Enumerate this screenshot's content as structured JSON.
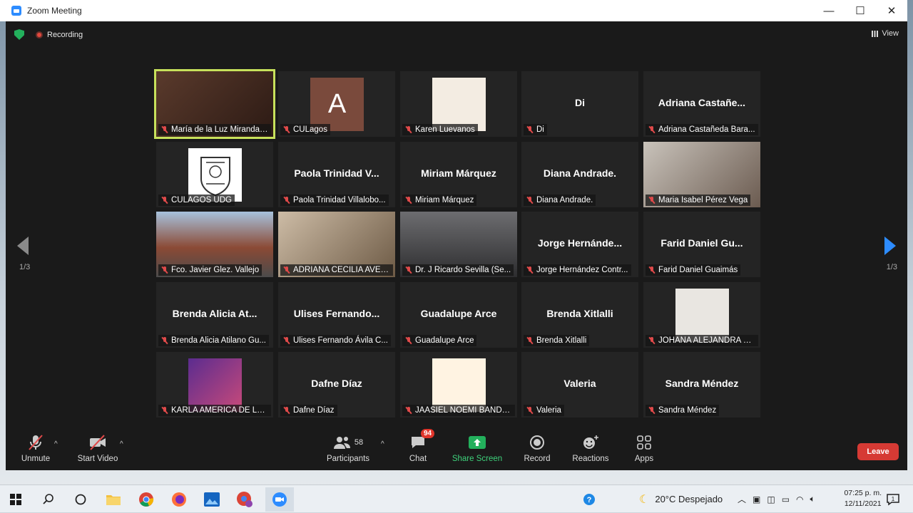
{
  "window": {
    "title": "Zoom Meeting",
    "min": "—",
    "max": "☐",
    "close": "✕"
  },
  "meeting": {
    "recording_label": "Recording",
    "view_label": "View"
  },
  "pager": {
    "left": "1/3",
    "right": "1/3"
  },
  "tiles": [
    {
      "label": "María de la Luz Miranda B...",
      "big": "",
      "kind": "photo",
      "active": true
    },
    {
      "label": "CULagos",
      "big": "",
      "kind": "avatar",
      "letter": "A"
    },
    {
      "label": "Karen Luevanos",
      "big": "",
      "kind": "photo"
    },
    {
      "label": "Di",
      "big": "Di",
      "kind": "name"
    },
    {
      "label": "Adriana Castañeda Bara...",
      "big": "Adriana  Castañe...",
      "kind": "name"
    },
    {
      "label": "CULAGOS UDG",
      "big": "",
      "kind": "logo"
    },
    {
      "label": "Paola Trinidad Villalobo...",
      "big": "Paola  Trinidad  V...",
      "kind": "name"
    },
    {
      "label": "Miriam Márquez",
      "big": "Miriam Márquez",
      "kind": "name"
    },
    {
      "label": "Diana Andrade.",
      "big": "Diana Andrade.",
      "kind": "name"
    },
    {
      "label": "Maria Isabel Pérez Vega",
      "big": "",
      "kind": "photo"
    },
    {
      "label": "Fco. Javier Glez. Vallejo",
      "big": "",
      "kind": "photo"
    },
    {
      "label": "ADRIANA CECILIA AVELA...",
      "big": "",
      "kind": "photo"
    },
    {
      "label": "Dr. J Ricardo Sevilla (Se...",
      "big": "",
      "kind": "photo"
    },
    {
      "label": "Jorge Hernández Contr...",
      "big": "Jorge  Hernánde...",
      "kind": "name"
    },
    {
      "label": "Farid Daniel Guaimás",
      "big": "Farid  Daniel  Gu...",
      "kind": "name"
    },
    {
      "label": "Brenda Alicia Atilano Gu...",
      "big": "Brenda  Alicia  At...",
      "kind": "name"
    },
    {
      "label": "Ulises Fernando Ávila C...",
      "big": "Ulises  Fernando...",
      "kind": "name"
    },
    {
      "label": "Guadalupe Arce",
      "big": "Guadalupe Arce",
      "kind": "name"
    },
    {
      "label": "Brenda Xitlalli",
      "big": "Brenda Xitlalli",
      "kind": "name"
    },
    {
      "label": "JOHANA ALEJANDRA M...",
      "big": "",
      "kind": "photo"
    },
    {
      "label": "KARLA AMERICA DE LA ...",
      "big": "",
      "kind": "photo"
    },
    {
      "label": "Dafne Díaz",
      "big": "Dafne Díaz",
      "kind": "name"
    },
    {
      "label": "JAASIEL NOEMI BANDA ...",
      "big": "",
      "kind": "photo"
    },
    {
      "label": "Valeria",
      "big": "Valeria",
      "kind": "name"
    },
    {
      "label": "Sandra Méndez",
      "big": "Sandra Méndez",
      "kind": "name"
    }
  ],
  "toolbar": {
    "unmute": "Unmute",
    "start_video": "Start Video",
    "participants": "Participants",
    "participants_count": "58",
    "chat": "Chat",
    "chat_badge": "94",
    "share": "Share Screen",
    "record": "Record",
    "reactions": "Reactions",
    "apps": "Apps",
    "leave": "Leave"
  },
  "taskbar": {
    "weather": "20°C  Despejado",
    "time": "07:25 p. m.",
    "date": "12/11/2021"
  },
  "colors": {
    "accent": "#2d8cff",
    "active_border": "#c7e15b",
    "leave": "#d63a34",
    "share": "#23b05c"
  }
}
